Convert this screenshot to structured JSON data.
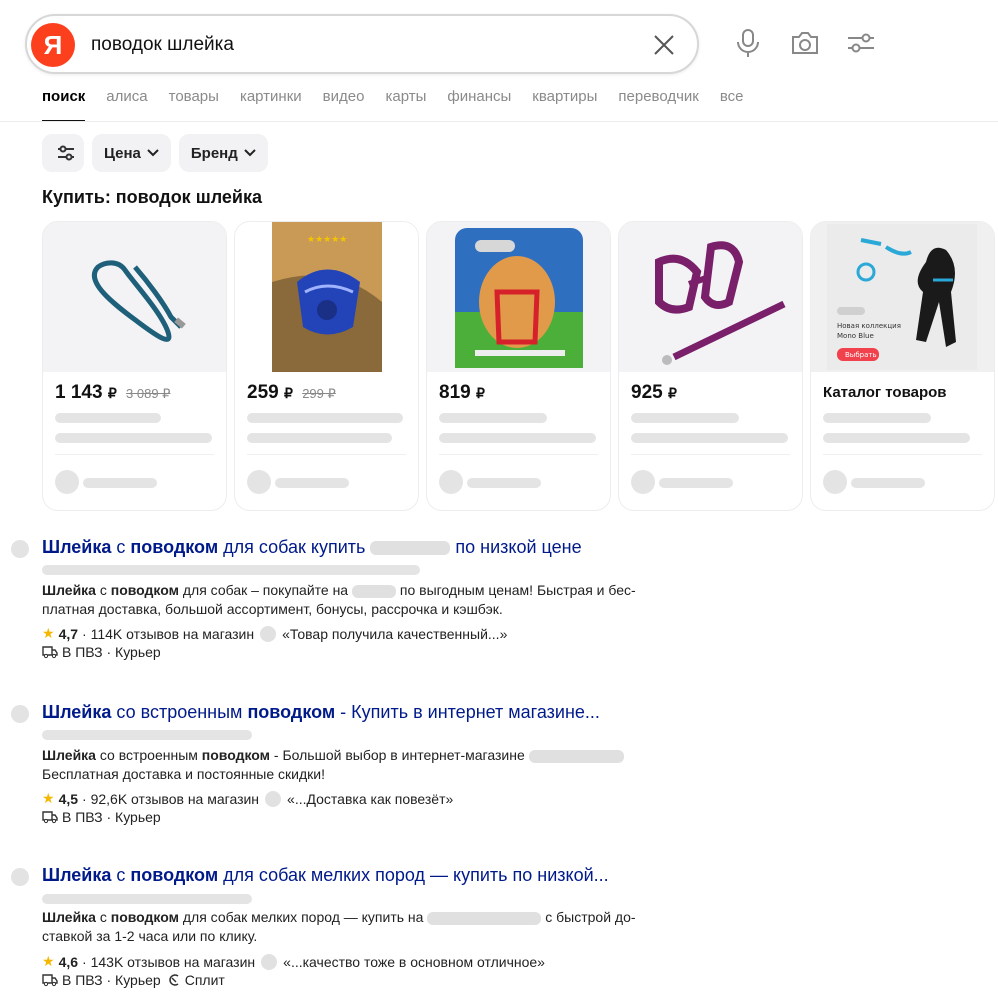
{
  "search": {
    "logo": "Я",
    "query": "поводок шлейка"
  },
  "tabs": [
    "поиск",
    "алиса",
    "товары",
    "картинки",
    "видео",
    "карты",
    "финансы",
    "квартиры",
    "переводчик",
    "все"
  ],
  "filters": {
    "price": "Цена",
    "brand": "Бренд"
  },
  "shop": {
    "title": "Купить: поводок шлейка",
    "cards": [
      {
        "price": "1 143",
        "currency": "₽",
        "old_price": "3 089 ₽"
      },
      {
        "price": "259",
        "currency": "₽",
        "old_price": "299 ₽"
      },
      {
        "price": "819",
        "currency": "₽",
        "old_price": ""
      },
      {
        "price": "925",
        "currency": "₽",
        "old_price": ""
      }
    ],
    "catalog": {
      "title": "Каталог товаров",
      "promo_line1": "Новая коллекция",
      "promo_line2": "Mono Blue",
      "promo_button": "Выбрать"
    }
  },
  "results": [
    {
      "title_a": "Шлейка",
      "title_b": " с ",
      "title_c": "поводком",
      "title_d": " для собак купить ",
      "title_e": " по низкой цене",
      "snip_a": "Шлейка",
      "snip_b": " с ",
      "snip_c": "поводком",
      "snip_d": " для собак – покупайте на ",
      "snip_e": " по выгодным ценам! Быстрая и бес-платная доставка, большой ассортимент, бонусы, рассрочка и кэшбэк.",
      "rating": "4,7",
      "reviews": "· 114K отзывов на магазин",
      "quote": "«Товар получила качественный...»",
      "delivery": "В ПВЗ · Курьер",
      "extra": ""
    },
    {
      "title_a": "Шлейка",
      "title_b": " со встроенным ",
      "title_c": "поводком",
      "title_d": " - Купить в интернет магазине...",
      "snip_a": "Шлейка",
      "snip_b": " со встроенным ",
      "snip_c": "поводком",
      "snip_d": " - Большой выбор в интернет-магазине ",
      "snip_e": " Бесплатная доставка и постоянные скидки!",
      "rating": "4,5",
      "reviews": "· 92,6K отзывов на магазин",
      "quote": "«...Доставка как повезёт»",
      "delivery": "В ПВЗ · Курьер",
      "extra": ""
    },
    {
      "title_a": "Шлейка",
      "title_b": " с ",
      "title_c": "поводком",
      "title_d": " для собак мелких пород — купить по низкой...",
      "snip_a": "Шлейка",
      "snip_b": " с ",
      "snip_c": "поводком",
      "snip_d": " для собак мелких пород — купить на ",
      "snip_e": " с быстрой до-ставкой за 1-2 часа или по клику.",
      "rating": "4,6",
      "reviews": "· 143K отзывов на магазин",
      "quote": "«...качество тоже в основном отличное»",
      "delivery": "В ПВЗ · Курьер",
      "extra": "Сплит"
    }
  ],
  "colors": {
    "brand": "#fc3f1d",
    "link": "#001a8a",
    "star": "#f5b700"
  }
}
